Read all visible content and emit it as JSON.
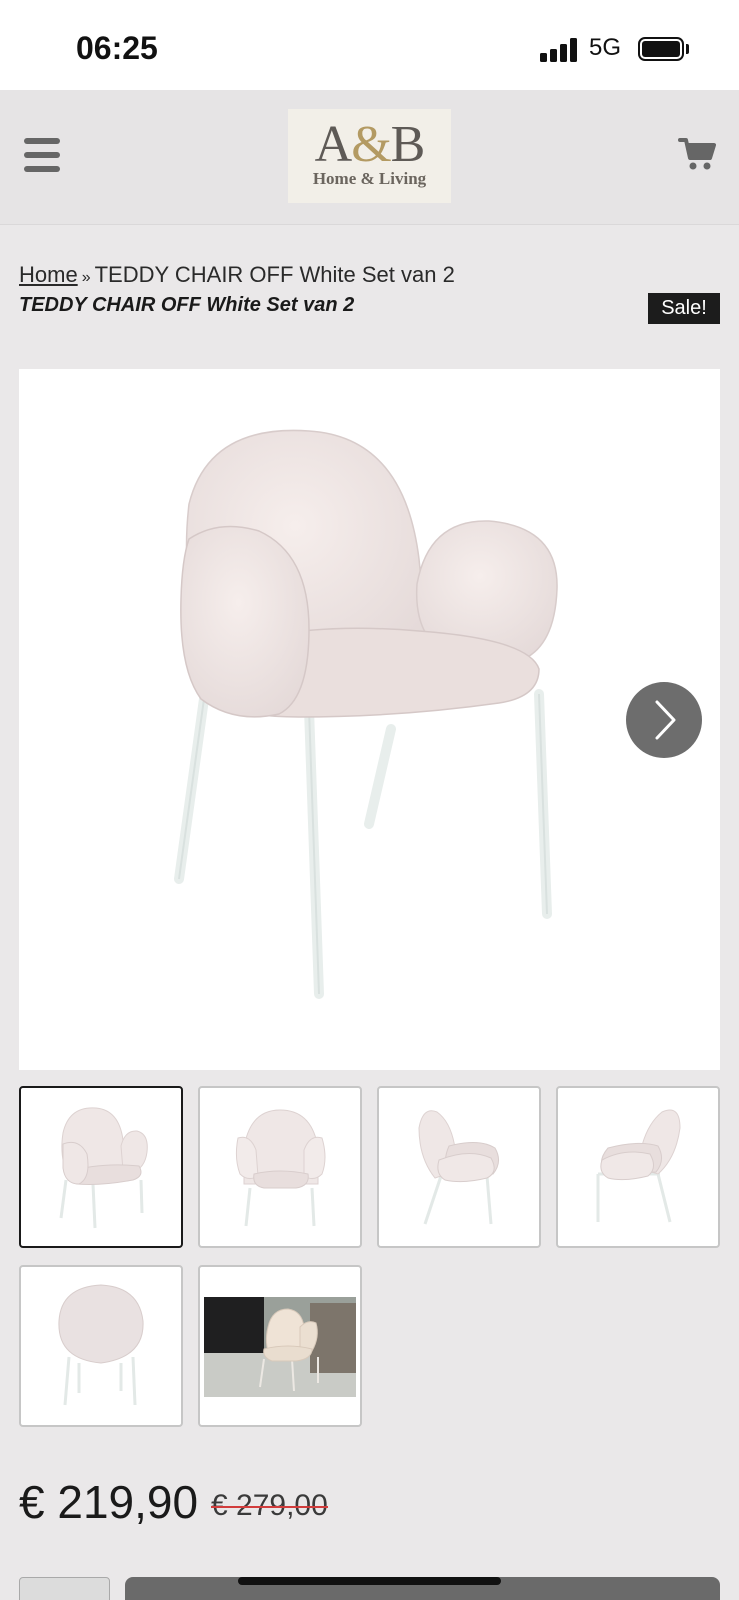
{
  "status_bar": {
    "time": "06:25",
    "network": "5G",
    "icons": [
      "signal-icon",
      "battery-icon"
    ]
  },
  "header": {
    "logo_main": "A&B",
    "logo_sub": "Home & Living",
    "icons": [
      "hamburger-menu-icon",
      "shopping-cart-icon"
    ]
  },
  "breadcrumb": {
    "home": "Home",
    "separator": "»",
    "current": "TEDDY CHAIR OFF White Set van 2"
  },
  "product": {
    "title": "TEDDY CHAIR OFF White Set van 2",
    "badge": "Sale!",
    "price_current": "€ 219,90",
    "price_old": "€ 279,00",
    "gallery_count": 6,
    "active_thumbnail": 1
  },
  "colors": {
    "background": "#eae8e9",
    "badge_bg": "#1c1c1c",
    "strike": "#d23c3c",
    "logo_gold": "#b39a62"
  }
}
